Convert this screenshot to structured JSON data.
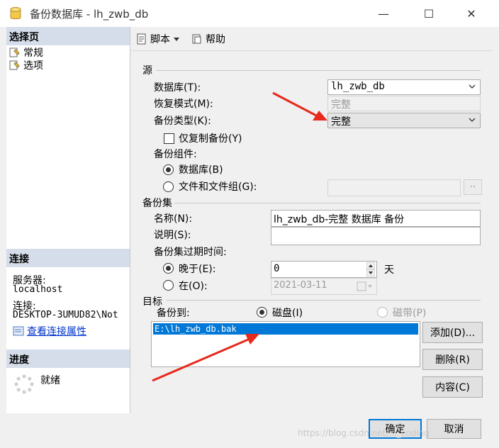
{
  "window": {
    "title": "备份数据库 - lh_zwb_db",
    "minimize": "—",
    "maximize": "☐",
    "close": "✕"
  },
  "left": {
    "select_page_header": "选择页",
    "pages": [
      "常规",
      "选项"
    ],
    "connection_header": "连接",
    "server_label": "服务器:",
    "server_value": "localhost",
    "connection_label": "连接:",
    "connection_value": "DESKTOP-3UMUD82\\Not",
    "view_props_link": "查看连接属性",
    "progress_header": "进度",
    "progress_status": "就绪"
  },
  "toolbar": {
    "script_label": "脚本",
    "help_label": "帮助"
  },
  "source": {
    "group_label": "源",
    "database_label": "数据库(T):",
    "database_value": "lh_zwb_db",
    "recovery_label": "恢复模式(M):",
    "recovery_value": "完整",
    "backup_type_label": "备份类型(K):",
    "backup_type_value": "完整",
    "copy_only_label": "仅复制备份(Y)",
    "component_label": "备份组件:",
    "component_database": "数据库(B)",
    "component_files": "文件和文件组(G):",
    "files_browse": "··"
  },
  "backup_set": {
    "group_label": "备份集",
    "name_label": "名称(N):",
    "name_value": "lh_zwb_db-完整 数据库 备份",
    "description_label": "说明(S):",
    "description_value": "",
    "expire_label": "备份集过期时间:",
    "after_label": "晚于(E):",
    "after_value": "0",
    "days_label": "天",
    "on_label": "在(O):",
    "on_value": "2021-03-11"
  },
  "destination": {
    "group_label": "目标",
    "backup_to_label": "备份到:",
    "disk_label": "磁盘(I)",
    "tape_label": "磁带(P)",
    "paths": [
      "E:\\lh_zwb_db.bak"
    ],
    "add_button": "添加(D)...",
    "remove_button": "删除(R)",
    "contents_button": "内容(C)"
  },
  "footer": {
    "ok_button": "确定",
    "cancel_button": "取消",
    "watermark": "https://blog.csdn.net/..._coding"
  },
  "colors": {
    "accent": "#0078d7",
    "section_header": "#d4dde9",
    "link": "#0033cc",
    "arrow_red": "#e8291c"
  }
}
